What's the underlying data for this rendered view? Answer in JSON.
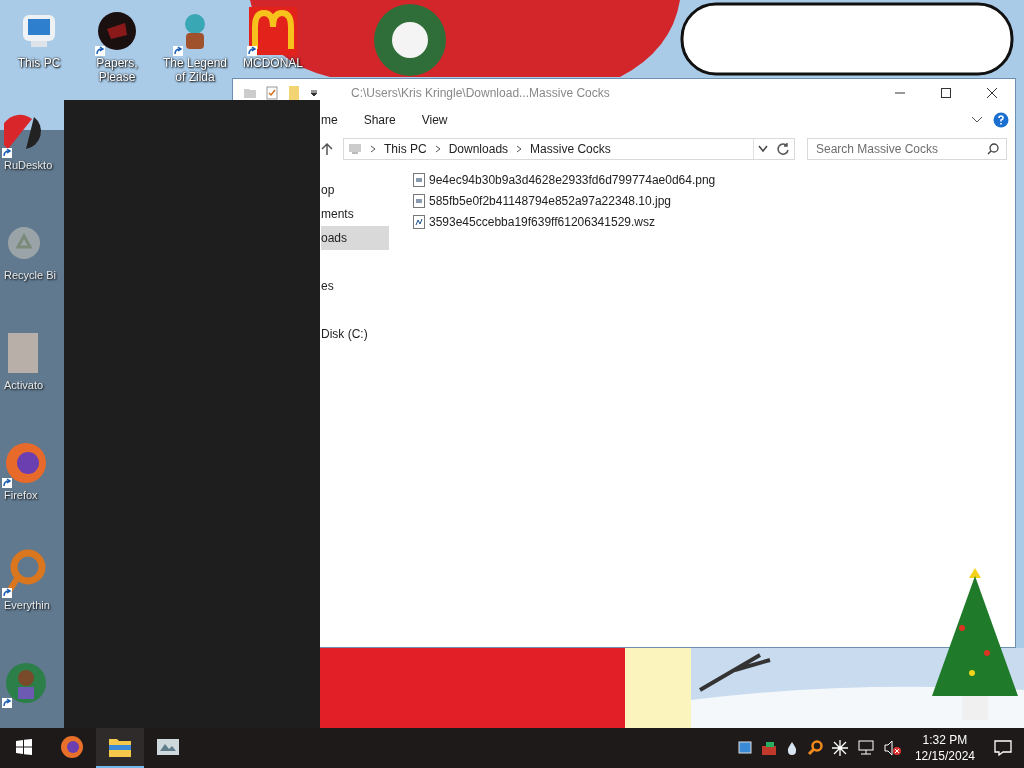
{
  "desktop_top_icons": [
    {
      "label": "This PC",
      "kind": "computer",
      "shortcut": false
    },
    {
      "label": "Papers, Please",
      "kind": "seal",
      "shortcut": true
    },
    {
      "label": "The Legend of Zilda",
      "kind": "figure",
      "shortcut": true
    },
    {
      "label": "MCDONAL",
      "kind": "arches",
      "shortcut": true
    }
  ],
  "desktop_side_icons": [
    {
      "label": "RuDeskto",
      "kind": "remote",
      "shortcut": true
    },
    {
      "label": "Recycle Bi",
      "kind": "bin",
      "shortcut": false
    },
    {
      "label": "Activato",
      "kind": "file",
      "shortcut": false
    },
    {
      "label": "Firefox",
      "kind": "browser",
      "shortcut": true
    },
    {
      "label": "Everythin",
      "kind": "magnifier",
      "shortcut": true
    },
    {
      "kind": "figure",
      "shortcut": true
    }
  ],
  "explorer": {
    "title": "C:\\Users\\Kris Kringle\\Download...Massive Cocks",
    "ribbon_tabs": [
      "me",
      "Share",
      "View"
    ],
    "address": [
      "This PC",
      "Downloads",
      "Massive Cocks"
    ],
    "search": {
      "placeholder": "Search Massive Cocks"
    },
    "nav_items": [
      {
        "label": "op",
        "selected": false
      },
      {
        "label": "ments",
        "selected": false
      },
      {
        "label": "oads",
        "selected": true
      },
      {
        "label": "es",
        "selected": false
      },
      {
        "label": "Disk (C:)",
        "selected": false
      }
    ],
    "files": [
      {
        "name": "9e4ec94b30b9a3d4628e2933fd6d799774ae0d64.png",
        "kind": "image"
      },
      {
        "name": "585fb5e0f2b41148794e852a97a22348.10.jpg",
        "kind": "image"
      },
      {
        "name": "3593e45ccebba19f639ff61206341529.wsz",
        "kind": "audio"
      }
    ]
  },
  "taskbar": {
    "apps": [
      {
        "kind": "browser",
        "active": false
      },
      {
        "kind": "folder",
        "active": true
      },
      {
        "kind": "viewer",
        "active": false
      }
    ],
    "time": "1:32 PM",
    "date": "12/15/2024"
  }
}
